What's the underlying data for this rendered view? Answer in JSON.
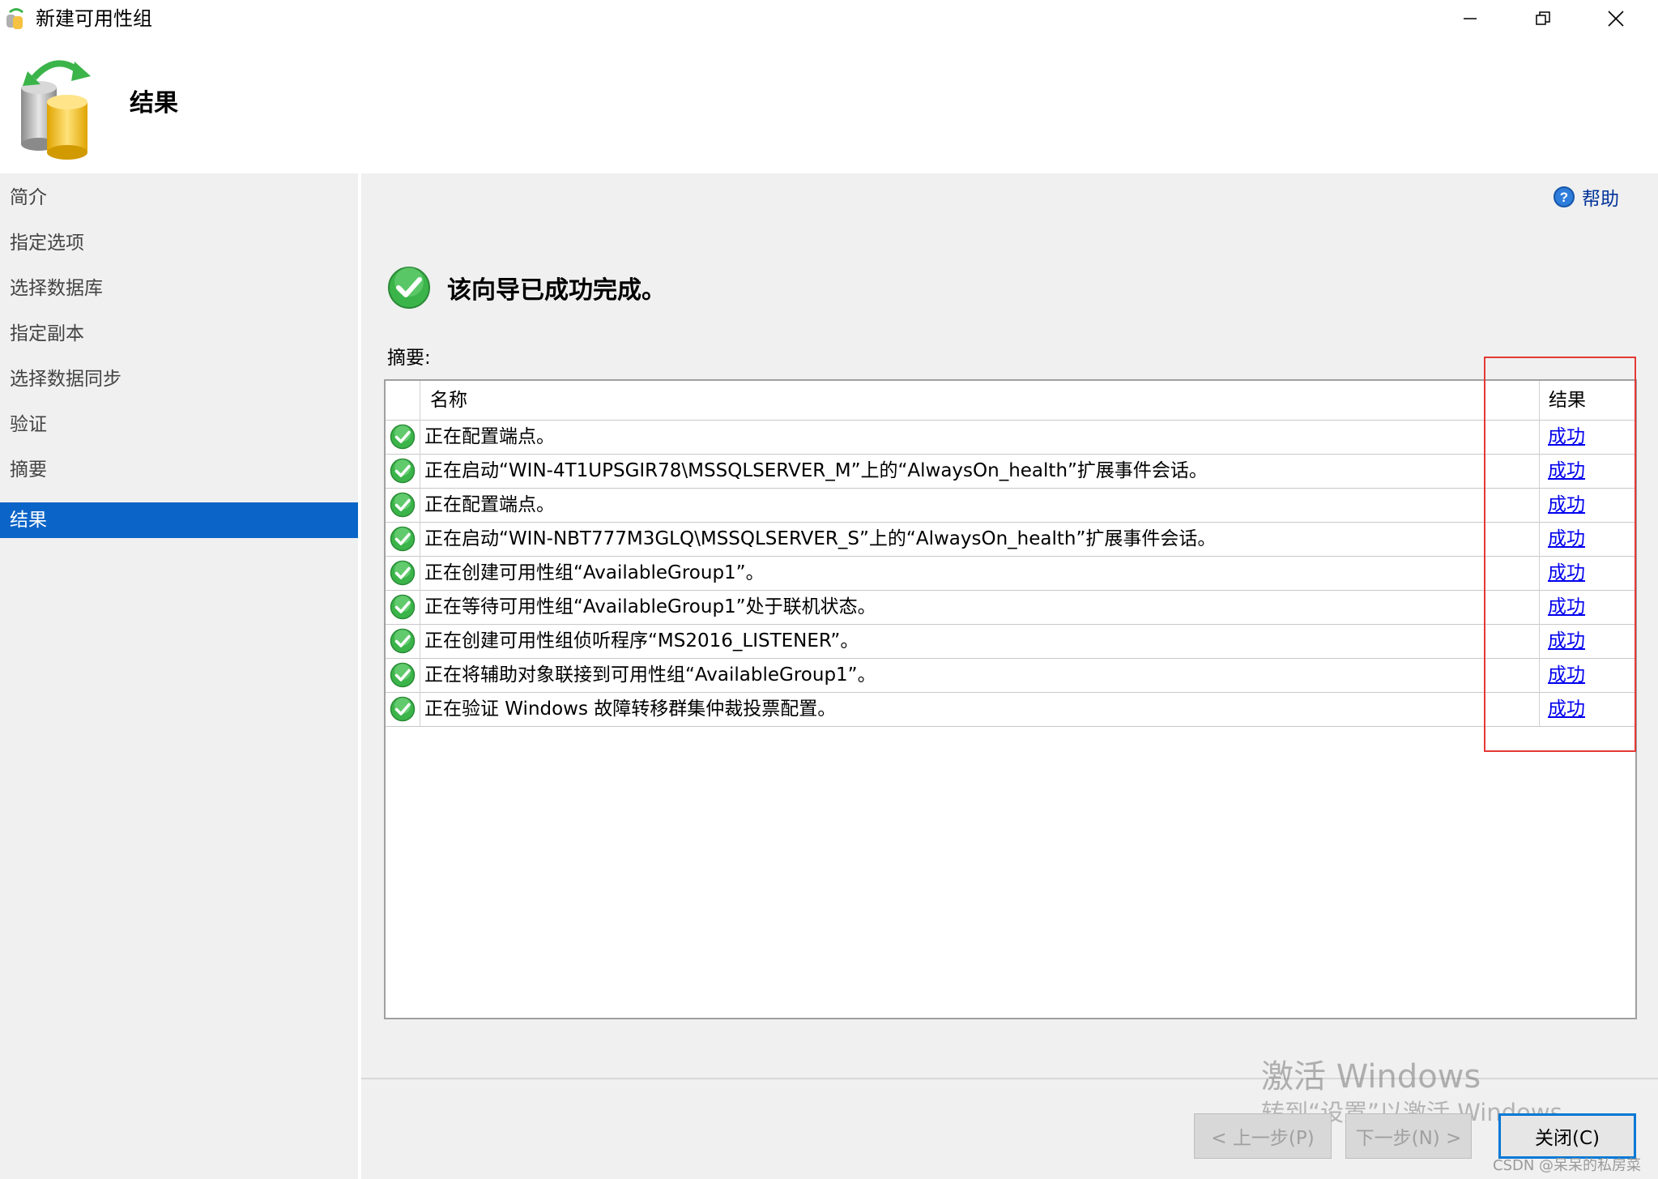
{
  "window": {
    "title": "新建可用性组"
  },
  "header": {
    "title": "结果"
  },
  "sidebar": {
    "items": [
      {
        "label": "简介",
        "active": false
      },
      {
        "label": "指定选项",
        "active": false
      },
      {
        "label": "选择数据库",
        "active": false
      },
      {
        "label": "指定副本",
        "active": false
      },
      {
        "label": "选择数据同步",
        "active": false
      },
      {
        "label": "验证",
        "active": false
      },
      {
        "label": "摘要",
        "active": false
      },
      {
        "label": "结果",
        "active": true
      }
    ]
  },
  "main": {
    "help_label": "帮助",
    "success_message": "该向导已成功完成。",
    "summary_label": "摘要:",
    "table": {
      "columns": {
        "name": "名称",
        "result": "结果"
      },
      "rows": [
        {
          "name": "正在配置端点。",
          "result": "成功"
        },
        {
          "name": "正在启动“WIN-4T1UPSGIR78\\MSSQLSERVER_M”上的“AlwaysOn_health”扩展事件会话。",
          "result": "成功"
        },
        {
          "name": "正在配置端点。",
          "result": "成功"
        },
        {
          "name": "正在启动“WIN-NBT777M3GLQ\\MSSQLSERVER_S”上的“AlwaysOn_health”扩展事件会话。",
          "result": "成功"
        },
        {
          "name": "正在创建可用性组“AvailableGroup1”。",
          "result": "成功"
        },
        {
          "name": "正在等待可用性组“AvailableGroup1”处于联机状态。",
          "result": "成功"
        },
        {
          "name": "正在创建可用性组侦听程序“MS2016_LISTENER”。",
          "result": "成功"
        },
        {
          "name": "正在将辅助对象联接到可用性组“AvailableGroup1”。",
          "result": "成功"
        },
        {
          "name": "正在验证 Windows 故障转移群集仲裁投票配置。",
          "result": "成功"
        }
      ]
    }
  },
  "footer": {
    "prev_label": "< 上一步(P)",
    "next_label": "下一步(N) >",
    "close_label": "关闭(C)"
  },
  "watermark": {
    "line1": "激活 Windows",
    "line2": "转到“设置”以激活 Windows。",
    "csdn": "CSDN @呆呆的私房菜"
  },
  "colors": {
    "accent": "#0b64c8",
    "highlight_box": "#e53935",
    "link": "#0000ee",
    "success": "#3bb44a"
  }
}
